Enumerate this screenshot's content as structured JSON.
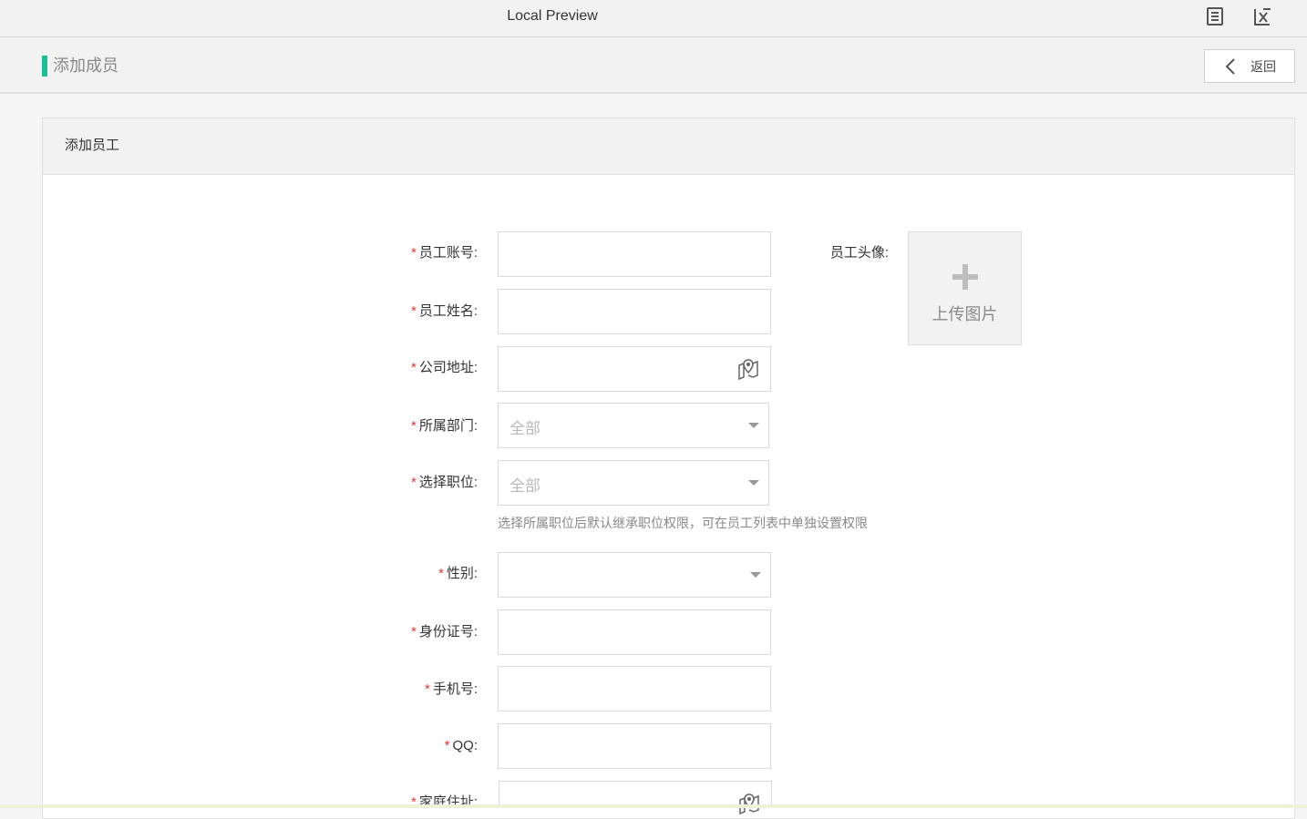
{
  "window": {
    "title": "Local Preview"
  },
  "header": {
    "title": "添加成员",
    "back_label": "返回"
  },
  "panel": {
    "title": "添加员工"
  },
  "form": {
    "account_label": "员工账号:",
    "name_label": "员工姓名:",
    "company_address_label": "公司地址:",
    "department_label": "所属部门:",
    "department_value": "全部",
    "position_label": "选择职位:",
    "position_value": "全部",
    "position_hint": "选择所属职位后默认继承职位权限，可在员工列表中单独设置权限",
    "gender_label": "性别:",
    "gender_value": "",
    "id_label": "身份证号:",
    "phone_label": "手机号:",
    "qq_label": "QQ:",
    "home_address_label": "家庭住址:",
    "required_mark": "*"
  },
  "avatar": {
    "label": "员工头像:",
    "upload_label": "上传图片"
  },
  "colors": {
    "accent": "#1cbf93",
    "required": "#e4393c"
  }
}
